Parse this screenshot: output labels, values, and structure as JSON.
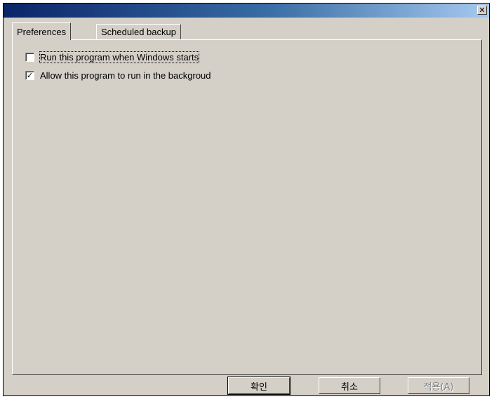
{
  "window": {
    "title": "",
    "close_glyph": "✕"
  },
  "tabs": [
    {
      "label": "Preferences",
      "active": true
    },
    {
      "label": "Scheduled backup",
      "active": false
    }
  ],
  "options": [
    {
      "label": "Run this program when Windows starts",
      "checked": false
    },
    {
      "label": "Allow this program to run in the backgroud",
      "checked": true
    }
  ],
  "buttons": {
    "ok_label": "확인",
    "cancel_label": "취소",
    "apply_label": "적용(A)"
  },
  "check_glyph": "✓"
}
